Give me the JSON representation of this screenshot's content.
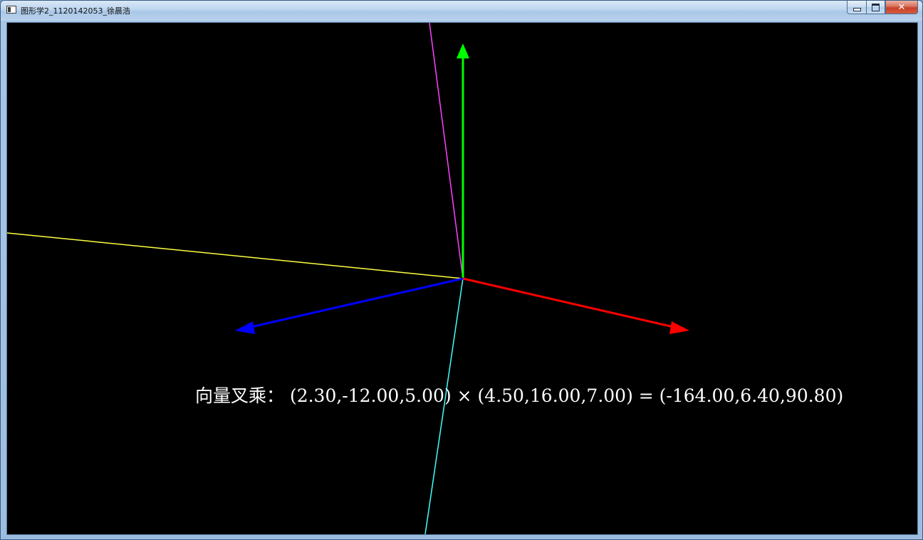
{
  "window": {
    "title": "图形学2_1120142053_徐晨浩",
    "minimize_label": "",
    "maximize_label": "",
    "close_label": "✕"
  },
  "scene": {
    "background_color": "#000000",
    "axes": {
      "x_axis_color": "#ff0000",
      "y_axis_color": "#00ff00",
      "z_axis_color": "#0000ff"
    },
    "vector_lines": {
      "vector_a_color": "#ffff40",
      "vector_b_color": "#ff40ff",
      "cross_product_color": "#40ffff"
    },
    "result_text": "向量叉乘： (2.30,-12.00,5.00) × (4.50,16.00,7.00) = (-164.00,6.40,90.80)"
  }
}
